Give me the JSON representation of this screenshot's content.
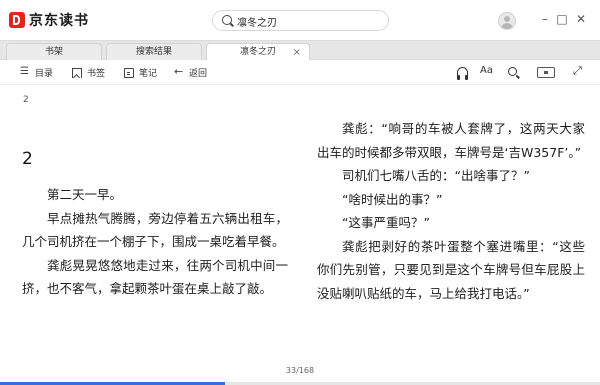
{
  "app": {
    "name": "京东读书"
  },
  "search": {
    "value": "凛冬之刃"
  },
  "tabs": [
    {
      "label": "书架"
    },
    {
      "label": "搜索结果"
    },
    {
      "label": "凛冬之刃"
    }
  ],
  "toolbar": {
    "toc_label": "目录",
    "bookmark_label": "书签",
    "notes_label": "笔记",
    "back_label": "返回",
    "font_label": "Aa"
  },
  "reader": {
    "page_label": "2",
    "chapter_title": "2",
    "left_paragraphs": [
      "第二天一早。",
      "早点摊热气腾腾，旁边停着五六辆出租车，几个司机挤在一个棚子下，围成一桌吃着早餐。",
      "龚彪晃晃悠悠地走过来，往两个司机中间一挤，也不客气，拿起颗茶叶蛋在桌上敲了敲。"
    ],
    "right_paragraphs": [
      "龚彪：“响哥的车被人套牌了，这两天大家出车的时候都多带双眼，车牌号是‘吉W357F’。”",
      "司机们七嘴八舌的：“出啥事了？”",
      "“啥时候出的事？”",
      "“这事严重吗？”",
      "龚彪把剥好的茶叶蛋整个塞进嘴里：“这些你们先别管，只要见到是这个车牌号但车屁股上没贴喇叭贴纸的车，马上给我打电话。”"
    ],
    "page_counter": "33/168",
    "progress": 0.375
  },
  "colors": {
    "brand": "#e1251b",
    "progress": "#3b6fd1"
  }
}
